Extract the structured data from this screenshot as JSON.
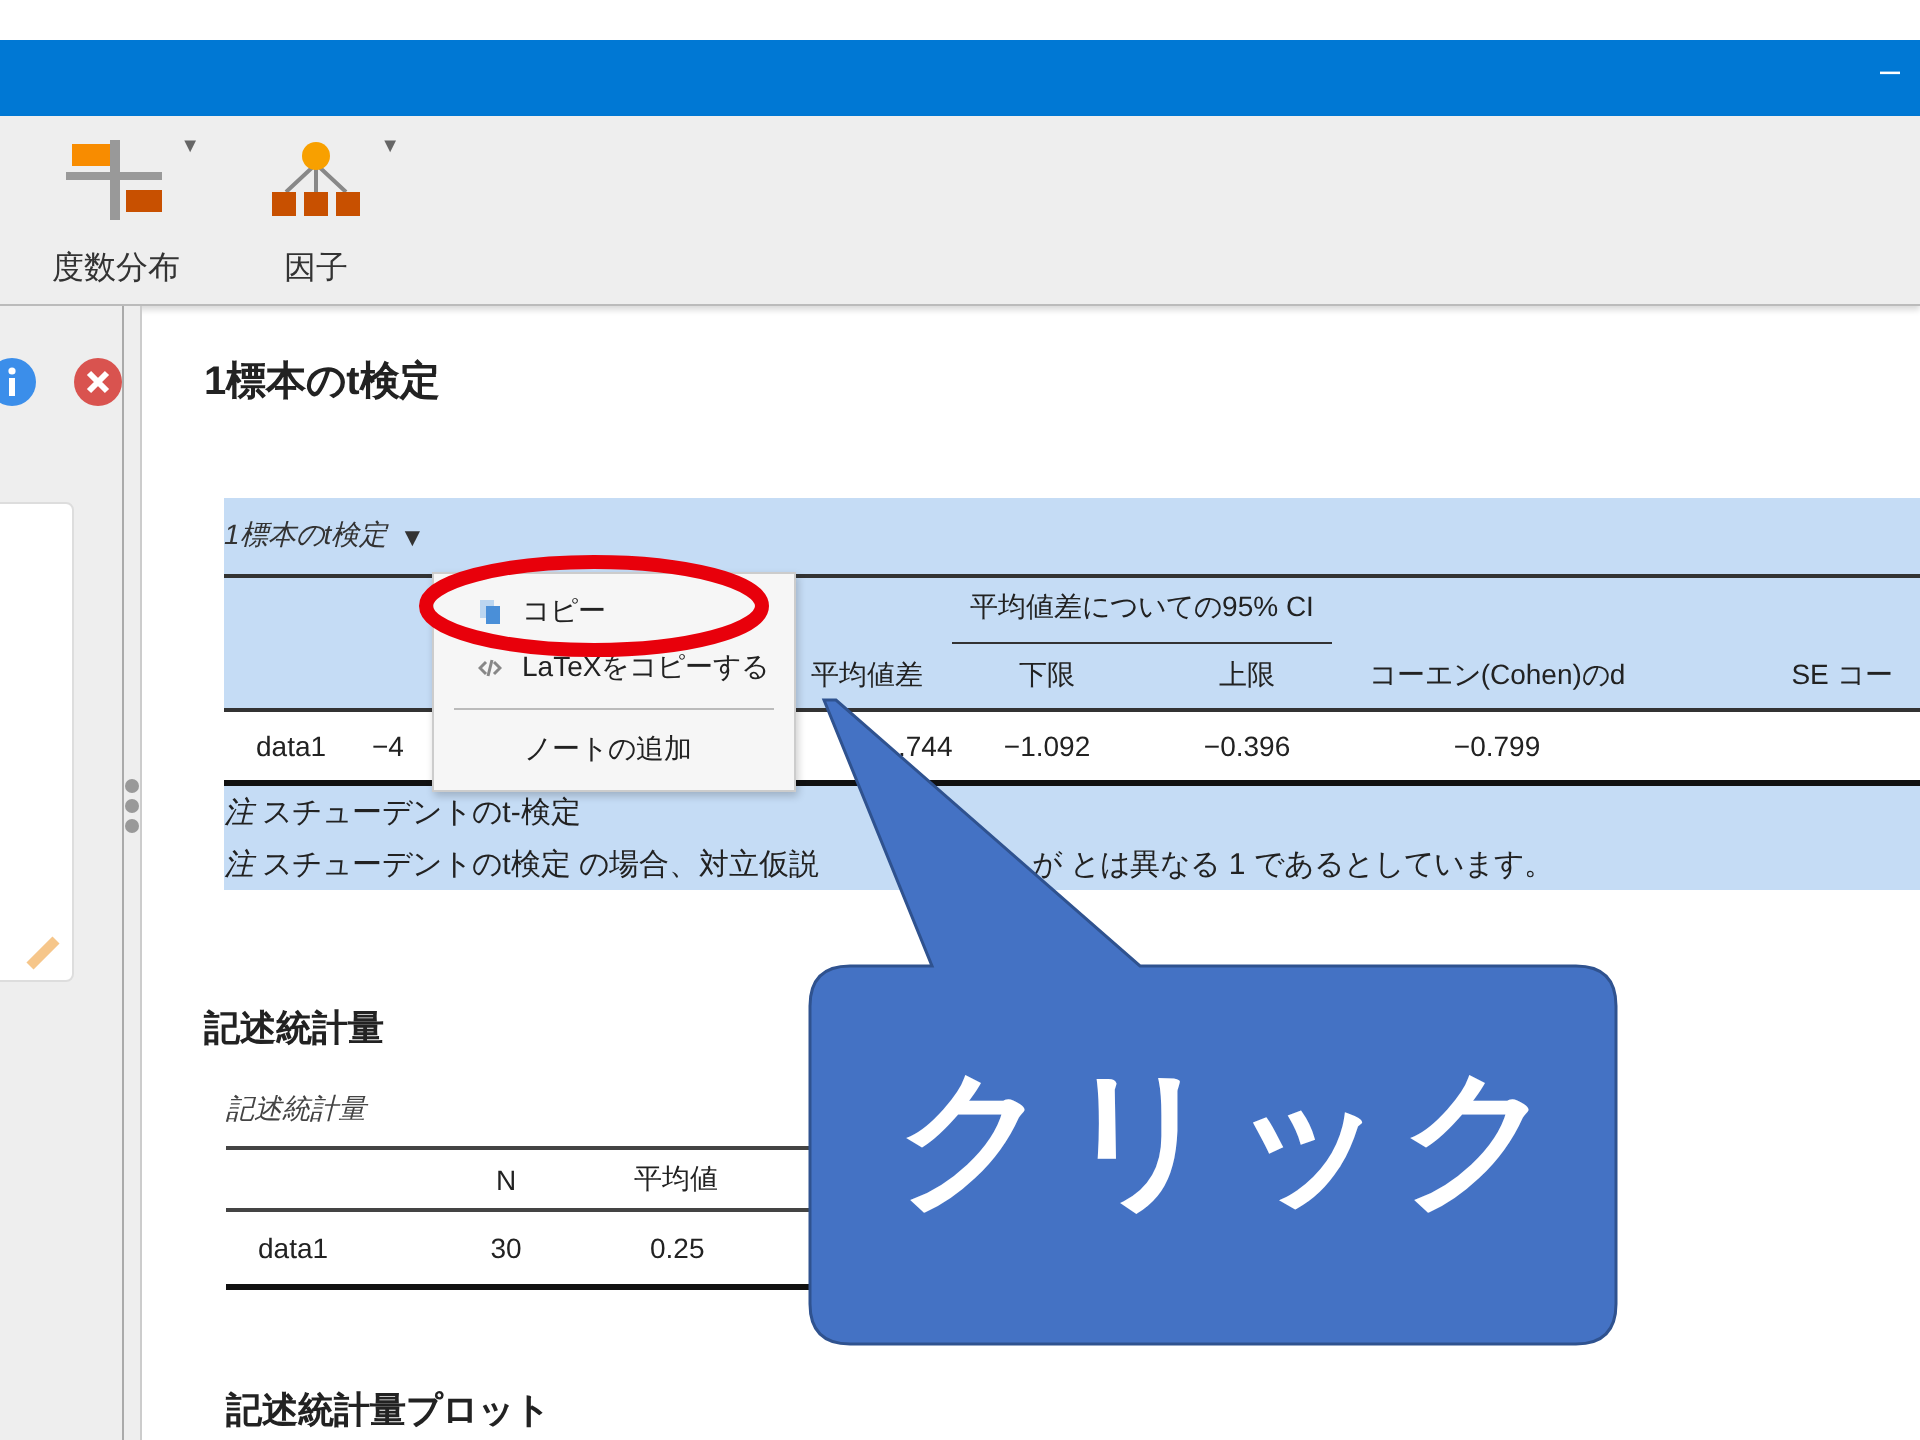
{
  "window": {
    "minimize": "–"
  },
  "toolbar": [
    {
      "label": "度数分布",
      "kind": "frequencies",
      "menu": "▼"
    },
    {
      "label": "因子",
      "kind": "factor",
      "menu": "▼"
    }
  ],
  "results": {
    "title": "1標本のt検定",
    "ttest_table": {
      "title": "1標本のt検定",
      "toggle": "▼",
      "group_header": "平均値差についての95% CI",
      "columns": [
        null,
        null,
        "平均値差",
        "下限",
        "上限",
        "コーエン(Cohen)のd",
        "SE コー"
      ],
      "rows": [
        [
          "data1",
          "−4",
          ".744",
          "−1.092",
          "−0.396",
          "−0.799",
          null
        ]
      ],
      "notes": [
        [
          "*注* スチューデントのt-検定"
        ],
        [
          "*注* スチューデントのt検定 の場合、対立仮説",
          "が とは異なる 1 であるとしています。"
        ]
      ]
    },
    "context_menu": [
      {
        "kind": "copy",
        "label": "コピー"
      },
      {
        "kind": "latex",
        "label": "LaTeXをコピーする"
      },
      {
        "kind": "separator"
      },
      {
        "kind": "note",
        "label": "ノートの追加"
      }
    ],
    "descriptives": {
      "heading": "記述統計量",
      "table_title": "記述統計量",
      "columns": [
        null,
        "N",
        "平均値"
      ],
      "rows": [
        [
          "data1",
          "30",
          "0.25"
        ]
      ]
    },
    "plot_heading": "記述統計量プロット"
  },
  "annotation": {
    "text": "クリック"
  }
}
